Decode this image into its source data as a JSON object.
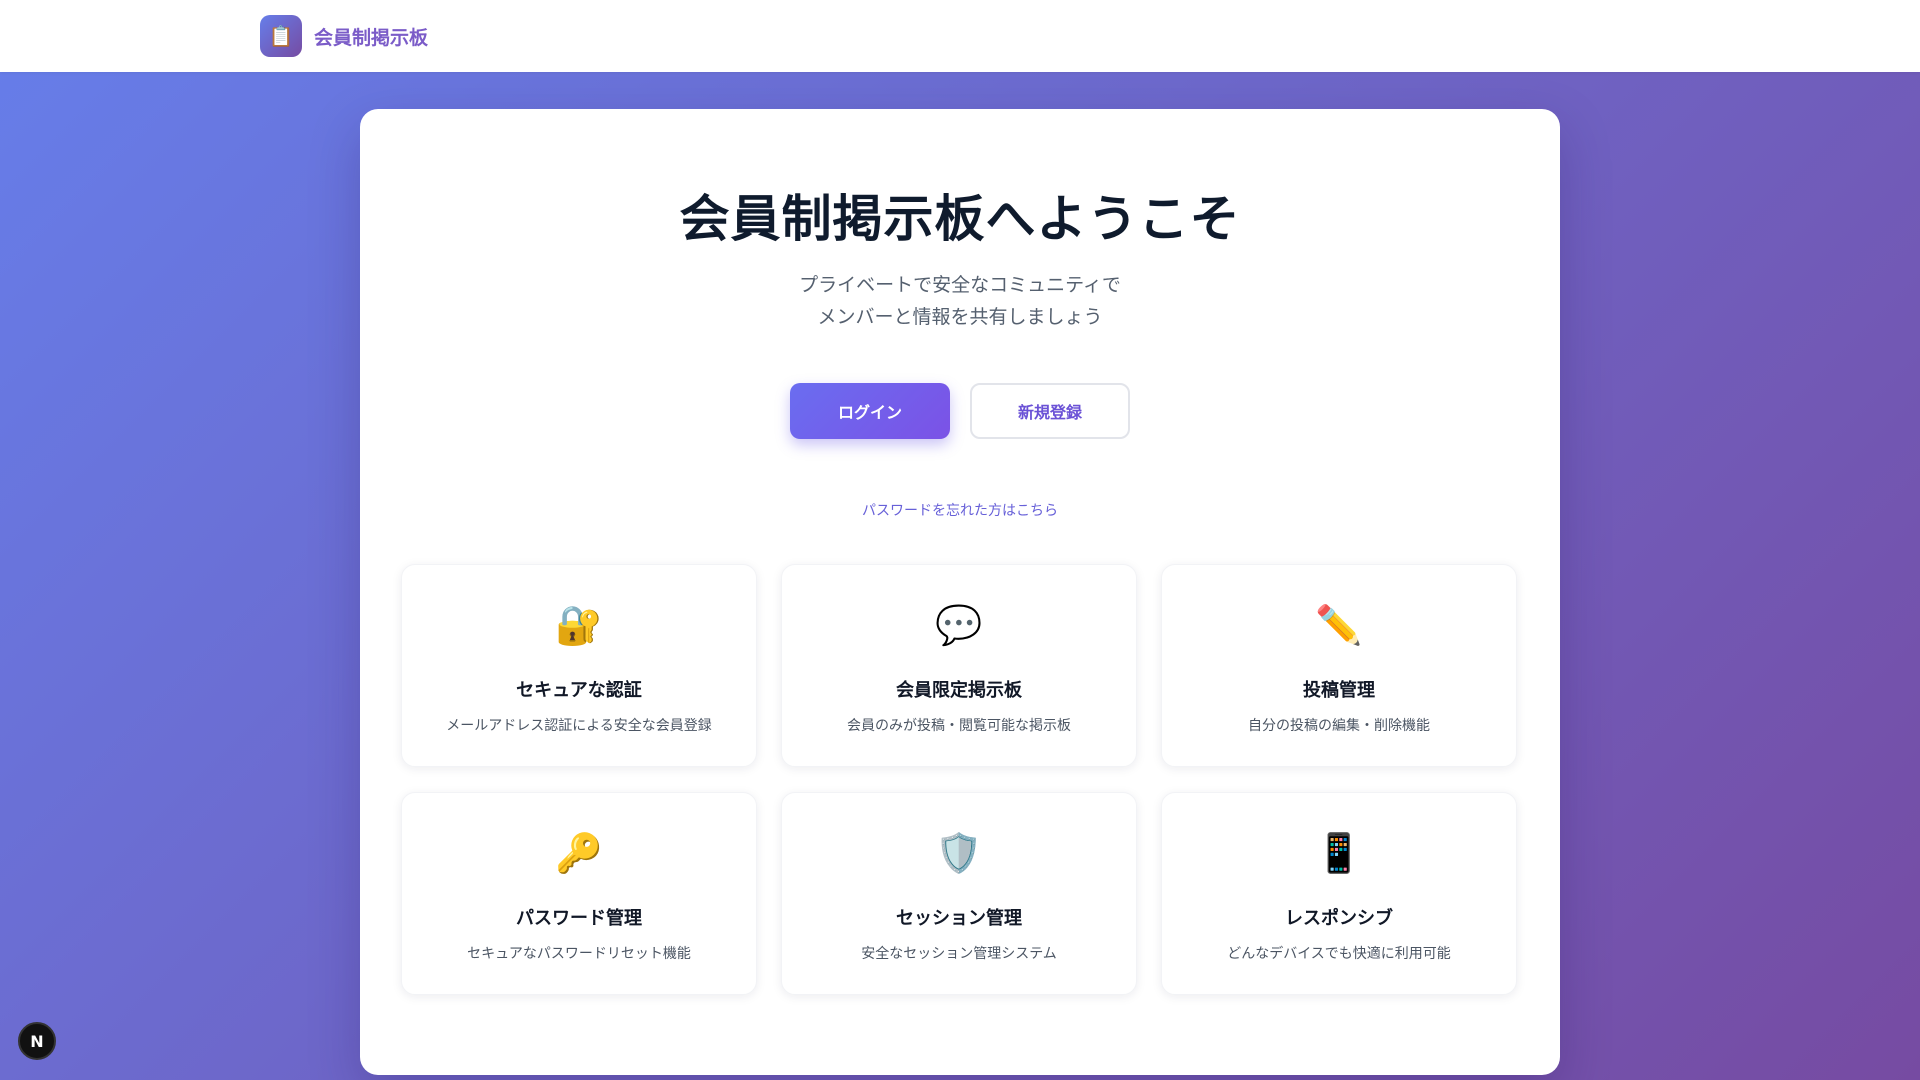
{
  "header": {
    "logo_icon": "📋",
    "title": "会員制掲示板"
  },
  "hero": {
    "title": "会員制掲示板へようこそ",
    "subtitle_line1": "プライベートで安全なコミュニティで",
    "subtitle_line2": "メンバーと情報を共有しましょう"
  },
  "actions": {
    "login_label": "ログイン",
    "register_label": "新規登録",
    "forgot_password_label": "パスワードを忘れた方はこちら"
  },
  "features": [
    {
      "icon": "🔐",
      "icon_name": "lock-key-icon",
      "title": "セキュアな認証",
      "description": "メールアドレス認証による安全な会員登録"
    },
    {
      "icon": "💬",
      "icon_name": "speech-bubble-icon",
      "title": "会員限定掲示板",
      "description": "会員のみが投稿・閲覧可能な掲示板"
    },
    {
      "icon": "✏️",
      "icon_name": "pencil-icon",
      "title": "投稿管理",
      "description": "自分の投稿の編集・削除機能"
    },
    {
      "icon": "🔑",
      "icon_name": "key-icon",
      "title": "パスワード管理",
      "description": "セキュアなパスワードリセット機能"
    },
    {
      "icon": "🛡️",
      "icon_name": "shield-icon",
      "title": "セッション管理",
      "description": "安全なセッション管理システム"
    },
    {
      "icon": "📱",
      "icon_name": "mobile-phone-icon",
      "title": "レスポンシブ",
      "description": "どんなデバイスでも快適に利用可能"
    }
  ],
  "dev_badge": {
    "label": "N"
  },
  "colors": {
    "gradient_start": "#667eea",
    "gradient_end": "#764ba2",
    "accent": "#6b52d6",
    "title": "#0f1b2d"
  }
}
